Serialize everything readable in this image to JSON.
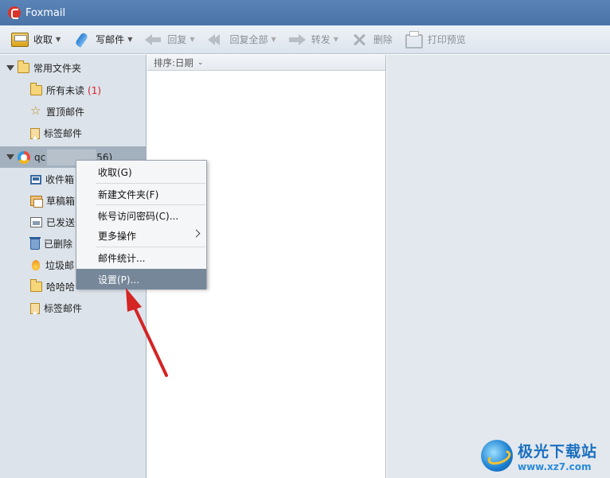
{
  "window": {
    "title": "Foxmail"
  },
  "toolbar": {
    "receive": "收取",
    "write": "写邮件",
    "reply": "回复",
    "reply_all": "回复全部",
    "forward": "转发",
    "delete": "删除",
    "print_preview": "打印预览"
  },
  "sidebar": {
    "common_folders": "常用文件夹",
    "common_items": [
      {
        "label": "所有未读",
        "count": "(1)",
        "icon": "folder-icon"
      },
      {
        "label": "置顶邮件",
        "icon": "star-icon"
      },
      {
        "label": "标签邮件",
        "icon": "bookmark-icon"
      }
    ],
    "account": {
      "prefix": "qc",
      "suffix": "56)"
    },
    "account_items": [
      {
        "label": "收件箱",
        "icon": "inbox-icon"
      },
      {
        "label": "草稿箱",
        "icon": "drafts-icon"
      },
      {
        "label": "已发送",
        "icon": "sent-icon"
      },
      {
        "label": "已删除",
        "icon": "trash-icon"
      },
      {
        "label": "垃圾邮",
        "icon": "spam-icon"
      },
      {
        "label": "哈哈哈",
        "icon": "folder-icon"
      },
      {
        "label": "标签邮件",
        "icon": "bookmark-icon"
      }
    ]
  },
  "list": {
    "sort_label": "排序:日期"
  },
  "context_menu": {
    "items": [
      {
        "label": "收取(G)"
      },
      {
        "label": "新建文件夹(F)"
      },
      {
        "label": "帐号访问密码(C)..."
      },
      {
        "label": "更多操作"
      },
      {
        "label": "邮件统计..."
      },
      {
        "label": "设置(P)..."
      }
    ],
    "selected": "设置(P)..."
  },
  "watermark": {
    "title": "极光下载站",
    "url": "www.xz7.com"
  },
  "colors": {
    "title_bar": "#4a74a8",
    "selected_menu": "#76879a",
    "annotation_arrow": "#d42424",
    "unread_count": "#d8202b"
  }
}
